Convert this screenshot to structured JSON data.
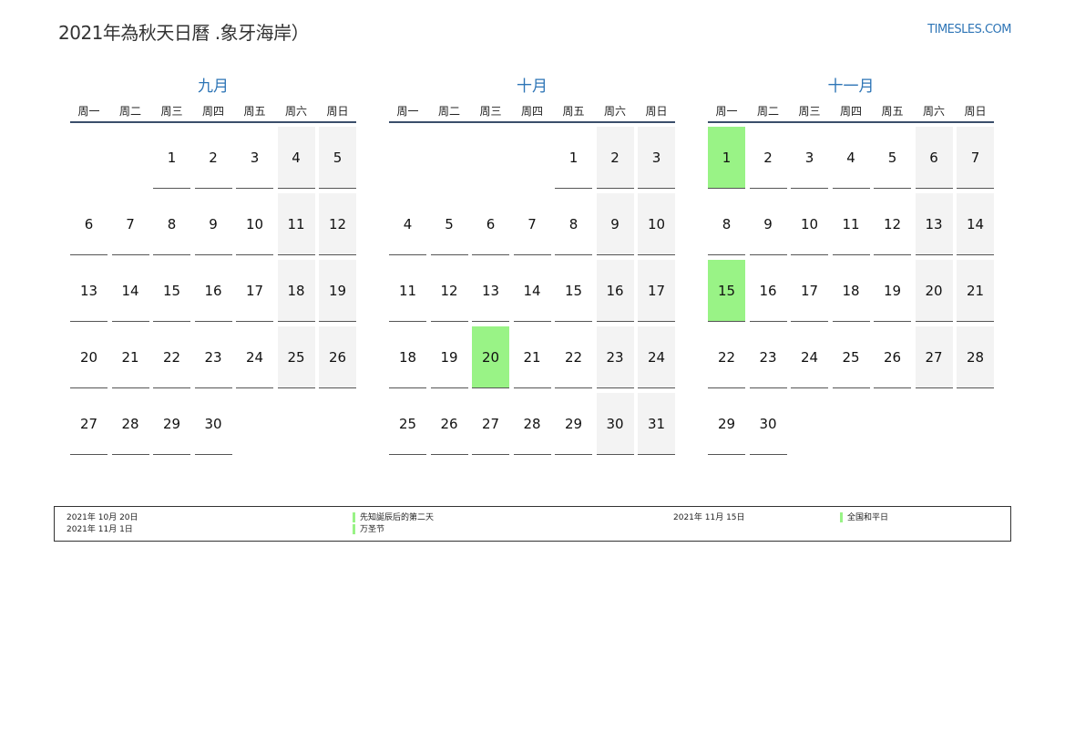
{
  "header": {
    "title": "2021年為秋天日曆 .象牙海岸）",
    "site": "TIMESLES.COM"
  },
  "weekdays": [
    "周一",
    "周二",
    "周三",
    "周四",
    "周五",
    "周六",
    "周日"
  ],
  "months": [
    {
      "name": "九月",
      "offset": 2,
      "days": [
        "1",
        "2",
        "3",
        "4",
        "5",
        "6",
        "7",
        "8",
        "9",
        "10",
        "11",
        "12",
        "13",
        "14",
        "15",
        "16",
        "17",
        "18",
        "19",
        "20",
        "21",
        "22",
        "23",
        "24",
        "25",
        "26",
        "27",
        "28",
        "29",
        "30"
      ],
      "holidays": []
    },
    {
      "name": "十月",
      "offset": 4,
      "days": [
        "1",
        "2",
        "3",
        "4",
        "5",
        "6",
        "7",
        "8",
        "9",
        "10",
        "11",
        "12",
        "13",
        "14",
        "15",
        "16",
        "17",
        "18",
        "19",
        "20",
        "21",
        "22",
        "23",
        "24",
        "25",
        "26",
        "27",
        "28",
        "29",
        "30",
        "31"
      ],
      "holidays": [
        "20"
      ]
    },
    {
      "name": "十一月",
      "offset": 0,
      "days": [
        "1",
        "2",
        "3",
        "4",
        "5",
        "6",
        "7",
        "8",
        "9",
        "10",
        "11",
        "12",
        "13",
        "14",
        "15",
        "16",
        "17",
        "18",
        "19",
        "20",
        "21",
        "22",
        "23",
        "24",
        "25",
        "26",
        "27",
        "28",
        "29",
        "30"
      ],
      "holidays": [
        "1",
        "15"
      ]
    }
  ],
  "legend": {
    "entries": [
      {
        "date": "2021年 10月 20日",
        "name": "先知誕辰后的第二天"
      },
      {
        "date": "2021年 11月 15日",
        "name": "全国和平日"
      },
      {
        "date": "2021年 11月 1日",
        "name": "万圣节"
      }
    ]
  },
  "colors": {
    "accent": "#2e75b6",
    "holiday": "#99f386",
    "weekend": "#f3f3f3"
  }
}
